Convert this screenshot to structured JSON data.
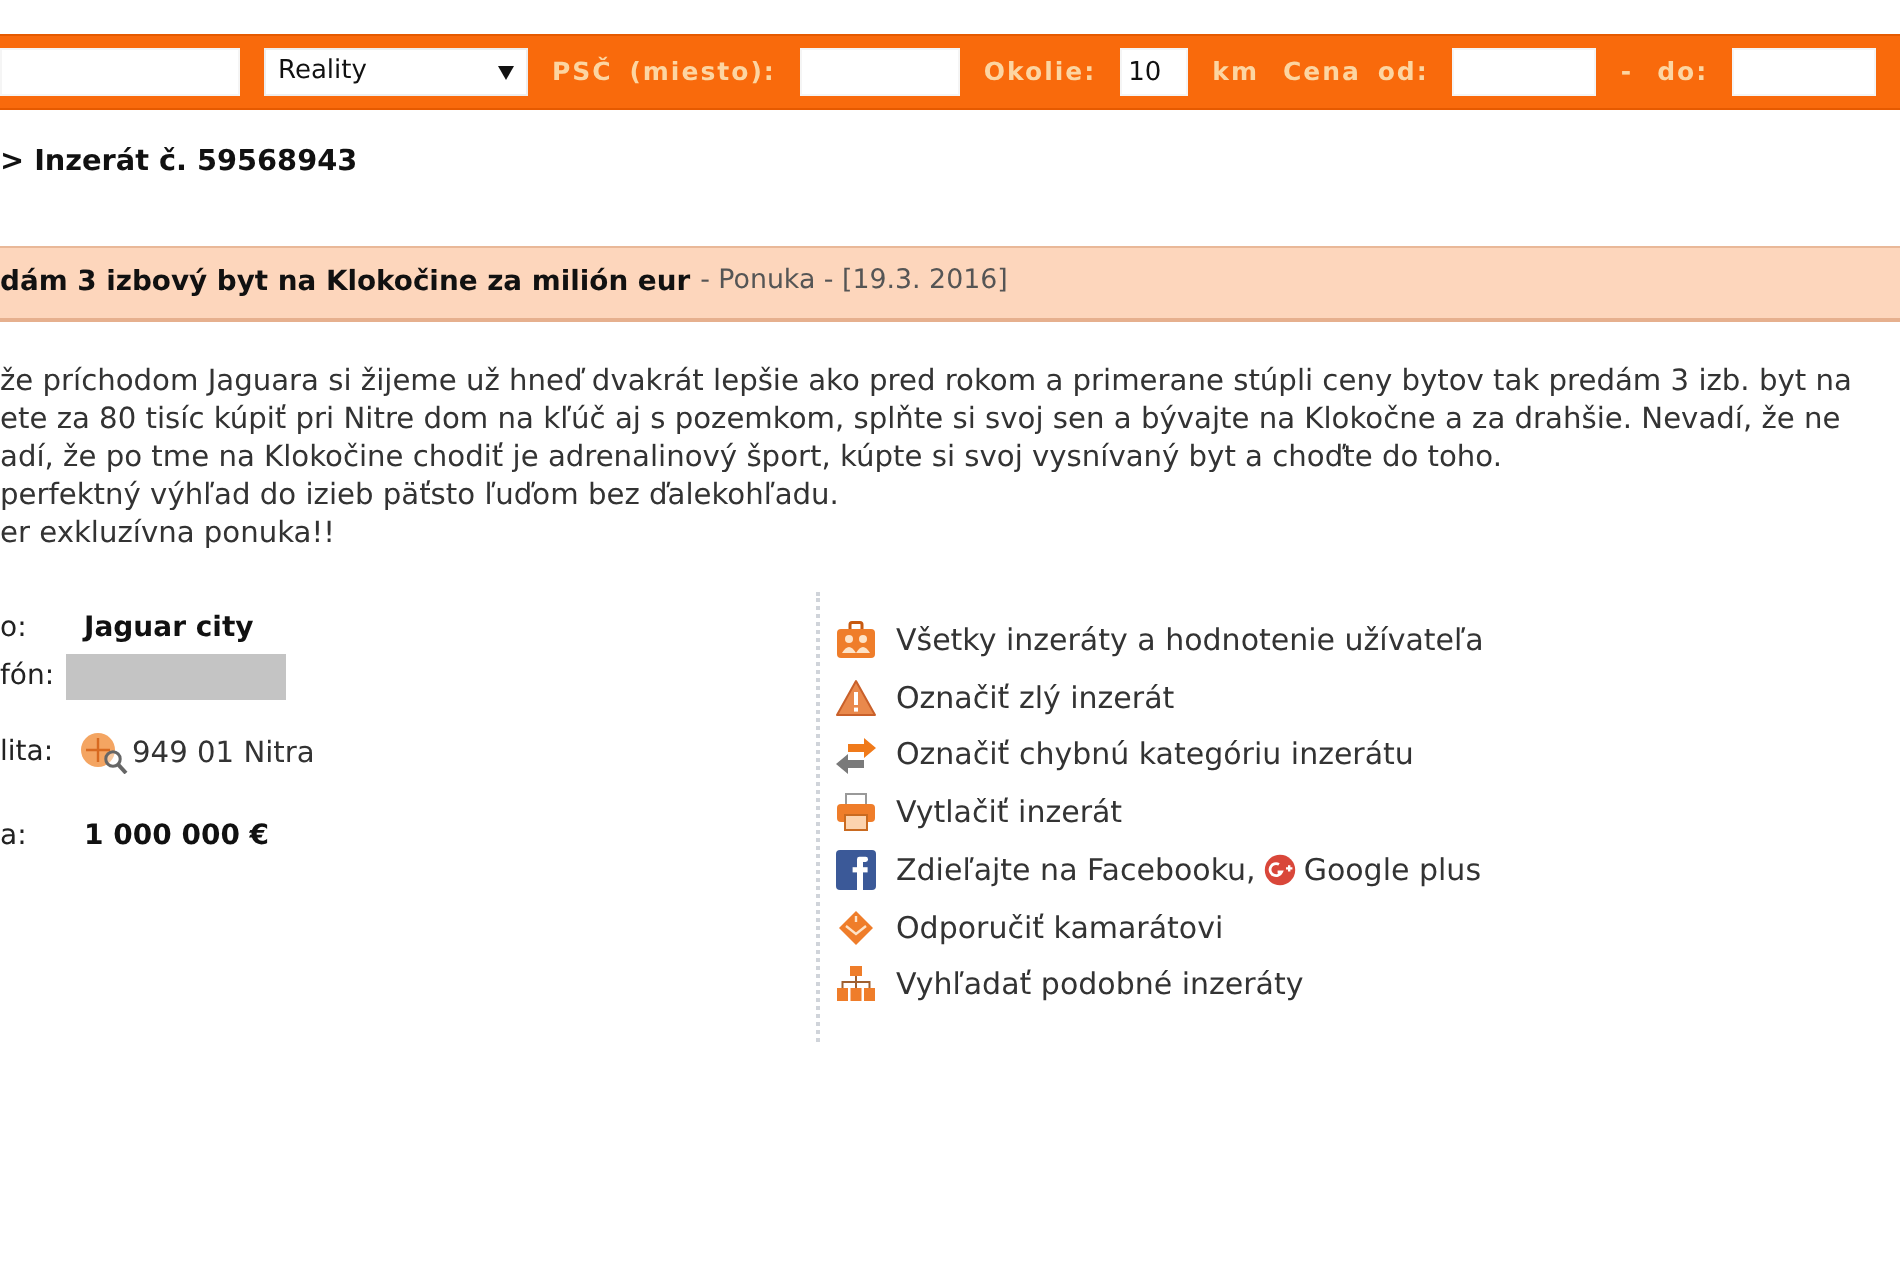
{
  "search_bar": {
    "items": [
      {
        "kind": "input"
      },
      {
        "kind": "select",
        "value": "Reality"
      },
      {
        "kind": "label",
        "text": "PSČ (miesto):"
      },
      {
        "kind": "input"
      },
      {
        "kind": "label",
        "text": "Okolie:"
      },
      {
        "kind": "input",
        "value": "10"
      },
      {
        "kind": "label",
        "text": "km"
      },
      {
        "kind": "label",
        "text": "Cena od:"
      },
      {
        "kind": "input"
      },
      {
        "kind": "label",
        "text": "-"
      },
      {
        "kind": "label",
        "text": "do:"
      },
      {
        "kind": "input"
      }
    ]
  },
  "breadcrumb": "> Inzerát č. 59568943",
  "ad_header": {
    "title": "dám 3 izbový byt na Klokočine za milión eur",
    "meta": "- Ponuka - [19.3. 2016]"
  },
  "description_lines": [
    "že príchodom Jaguara si žijeme už hneď dvakrát lepšie ako pred rokom a primerane stúpli ceny bytov tak predám 3 izb. byt na",
    "ete za 80 tisíc kúpiť pri Nitre dom na kľúč aj s pozemkom, splňte si svoj sen a bývajte na Klokočne a za drahšie. Nevadí, že ne",
    "adí, že po tme na Klokočine chodiť je adrenalinový šport, kúpte si svoj vysnívaný byt a choďte do toho.",
    "perfektný výhľad do izieb päťsto ľuďom bez ďalekohľadu.",
    "er exkluzívna ponuka!!"
  ],
  "details": [
    {
      "kind": "text",
      "label": "o:",
      "value": "Jaguar city"
    },
    {
      "kind": "redacted",
      "label": "fón:"
    },
    {
      "kind": "location",
      "label": "lita:",
      "value": "949 01 Nitra"
    },
    {
      "kind": "text",
      "label": "a:",
      "value": "1 000 000 €"
    }
  ],
  "actions": [
    {
      "links": [
        "Všetky inzeráty a hodnotenie užívateľa"
      ]
    },
    {
      "links": [
        "Označiť zlý inzerát"
      ]
    },
    {
      "links": [
        "Označiť chybnú kategóriu inzerátu"
      ]
    },
    {
      "links": [
        "Vytlačiť inzerát"
      ]
    },
    {
      "links": [
        "Zdieľajte na Facebooku,",
        "Google plus"
      ]
    },
    {
      "links": [
        "Odporučiť kamarátovi"
      ]
    },
    {
      "links": [
        "Vyhľadať podobné inzeráty"
      ]
    }
  ]
}
